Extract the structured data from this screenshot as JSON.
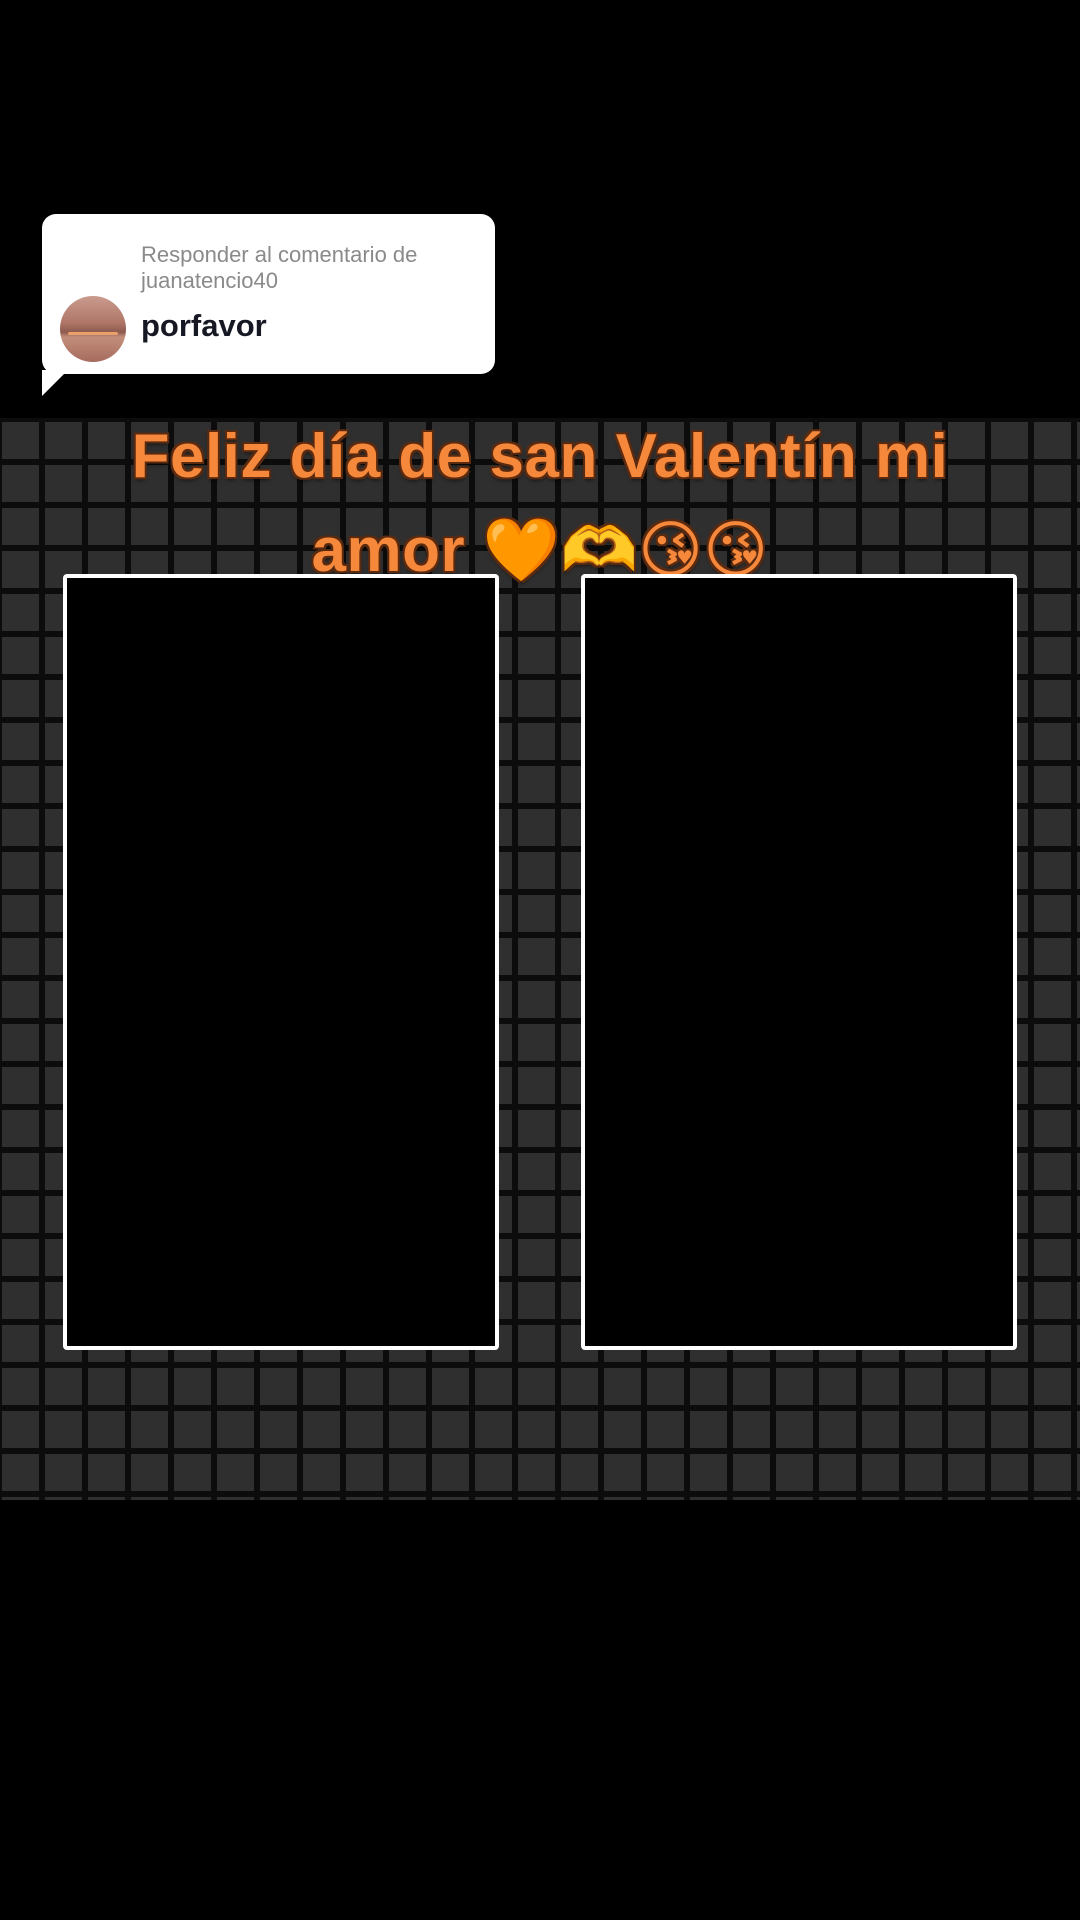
{
  "reply": {
    "header_line1": "Responder al comentario de",
    "header_line2": "juanatencio40",
    "comment": "porfavor"
  },
  "caption": {
    "line1": "Feliz día de san Valentín mi",
    "line2": "amor 🧡🫶😘😘"
  },
  "colors": {
    "caption": "#f5883a",
    "background": "#000000",
    "grid": "#2f2f2f",
    "frame_border": "#ffffff"
  }
}
